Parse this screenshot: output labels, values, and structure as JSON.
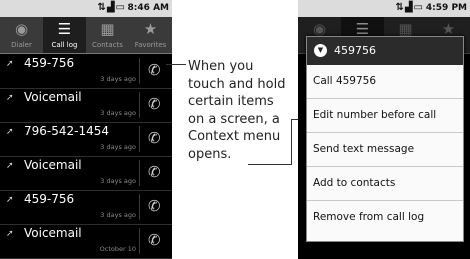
{
  "left_phone": {
    "status": {
      "time": "8:46 AM"
    },
    "tabs": [
      {
        "label": "Dialer",
        "icon": "dialer-icon",
        "glyph": "◉"
      },
      {
        "label": "Call log",
        "icon": "call-log-icon",
        "glyph": "☰"
      },
      {
        "label": "Contacts",
        "icon": "contacts-icon",
        "glyph": "▦"
      },
      {
        "label": "Favorites",
        "icon": "star-icon",
        "glyph": "★"
      }
    ],
    "calls": [
      {
        "name": "459-756",
        "date": "3 days ago"
      },
      {
        "name": "Voicemail",
        "date": "3 days ago"
      },
      {
        "name": "796-542-1454",
        "date": "3 days ago"
      },
      {
        "name": "Voicemail",
        "date": "3 days ago"
      },
      {
        "name": "459-756",
        "date": "3 days ago"
      },
      {
        "name": "Voicemail",
        "date": "October 10"
      }
    ]
  },
  "right_phone": {
    "status": {
      "time": "4:59 PM"
    },
    "menu": {
      "title": "459756",
      "items": [
        "Call 459756",
        "Edit number before call",
        "Send text message",
        "Add to contacts",
        "Remove from call log"
      ]
    }
  },
  "callout": {
    "text": "When you touch and hold certain items on a screen, a Context menu opens."
  }
}
